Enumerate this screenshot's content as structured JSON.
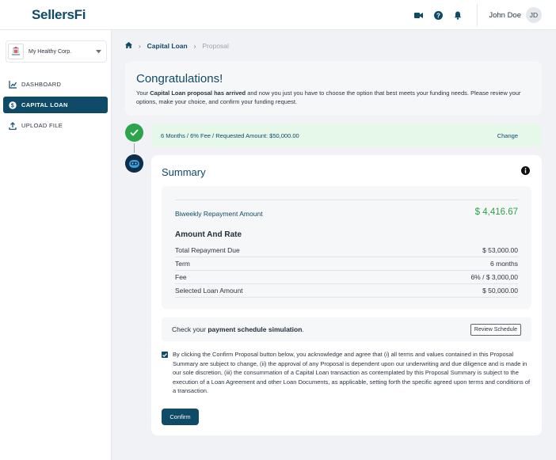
{
  "header": {
    "logo": "SellersFi",
    "user_name": "John Doe",
    "user_initials": "JD",
    "icons": [
      "video-icon",
      "help-icon",
      "bell-icon"
    ]
  },
  "sidebar": {
    "company_name": "My Healthy Corp.",
    "items": [
      {
        "label": "DASHBOARD",
        "icon": "chart-icon",
        "active": false
      },
      {
        "label": "CAPITAL LOAN",
        "icon": "dollar-icon",
        "active": true
      },
      {
        "label": "UPLOAD FILE",
        "icon": "upload-icon",
        "active": false
      }
    ]
  },
  "breadcrumb": {
    "items": [
      "Capital Loan",
      "Proposal"
    ]
  },
  "congrats": {
    "title": "Congratulations!",
    "text_prefix": "Your ",
    "text_bold": "Capital Loan proposal has arrived",
    "text_suffix": " and now you just you have to choose the option that best meets your funding needs. Please review your options, make your choice, and confirm your funding request."
  },
  "option": {
    "summary": "6 Months / 6% Fee / Requested Amount: $50,000.00",
    "change_label": "Change"
  },
  "summary": {
    "title": "Summary",
    "biweekly_label": "Biweekly Repayment Amount",
    "biweekly_amount": "$ 4,416.67",
    "section_title": "Amount And Rate",
    "rows": [
      {
        "label": "Total Repayment Due",
        "value": "$ 53,000.00"
      },
      {
        "label": "Term",
        "value": "6 months"
      },
      {
        "label": "Fee",
        "value": "6% / $ 3,000,00"
      },
      {
        "label": "Selected Loan Amount",
        "value": "$ 50,000.00"
      }
    ],
    "schedule_prefix": "Check your ",
    "schedule_bold": "payment schedule simulation",
    "schedule_suffix": ".",
    "review_button": "Review Schedule",
    "consent_checked": true,
    "consent_text": "By clicking the Confirm Proposal button below, you acknowledge and agree that (i) all terms and values contained in this Proposal Summary are subject to change, (ii) the approval of any Proposal is dependent upon our underwriting and due diligence and is made in our sole discretion, (iii) the consummation of a Capital Loan transaction as contemplated by this Proposal Summary is subject to the execution of a Loan Agreement and other Loan Documents, as applicable, setting forth the specific agreed upon terms and conditions of a transaction.",
    "confirm_button": "Confirm"
  },
  "colors": {
    "brand": "#0f4a66",
    "success": "#2ca44a",
    "option_bg": "#e5f8ea"
  }
}
